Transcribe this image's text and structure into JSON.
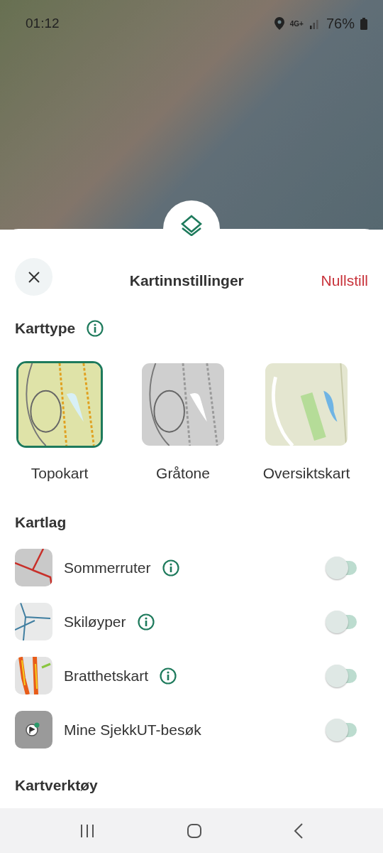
{
  "status_bar": {
    "time": "01:12",
    "network": "4G+",
    "battery": "76%"
  },
  "sheet": {
    "title": "Kartinnstillinger",
    "reset": "Nullstill"
  },
  "map_type": {
    "heading": "Karttype",
    "items": [
      {
        "label": "Topokart",
        "kind": "topo",
        "selected": true
      },
      {
        "label": "Gråtone",
        "kind": "gray",
        "selected": false
      },
      {
        "label": "Oversiktskart",
        "kind": "overview",
        "selected": false
      }
    ]
  },
  "layers": {
    "heading": "Kartlag",
    "items": [
      {
        "label": "Sommerruter",
        "kind": "summer",
        "info": true,
        "on": false
      },
      {
        "label": "Skiløyper",
        "kind": "ski",
        "info": true,
        "on": false
      },
      {
        "label": "Bratthetskart",
        "kind": "steep",
        "info": true,
        "on": false
      },
      {
        "label": "Mine SjekkUT-besøk",
        "kind": "visits",
        "info": false,
        "on": false
      }
    ]
  },
  "tools": {
    "heading": "Kartverktøy"
  }
}
